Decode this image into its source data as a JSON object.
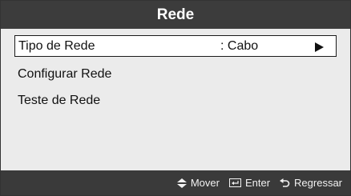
{
  "header": {
    "title": "Rede"
  },
  "menu": {
    "items": [
      {
        "label": "Tipo de Rede",
        "value": ": Cabo",
        "selected": true
      },
      {
        "label": "Configurar Rede"
      },
      {
        "label": "Teste de Rede"
      }
    ]
  },
  "footer": {
    "hints": [
      {
        "icon": "up-down-arrow-icon",
        "label": "Mover"
      },
      {
        "icon": "enter-icon",
        "label": "Enter"
      },
      {
        "icon": "return-icon",
        "label": "Regressar"
      }
    ]
  },
  "colors": {
    "titlebar": "#3c3c3c",
    "content_bg": "#ebebeb",
    "selected_bg": "#ffffff",
    "footer_bg": "#3a3a3a"
  }
}
